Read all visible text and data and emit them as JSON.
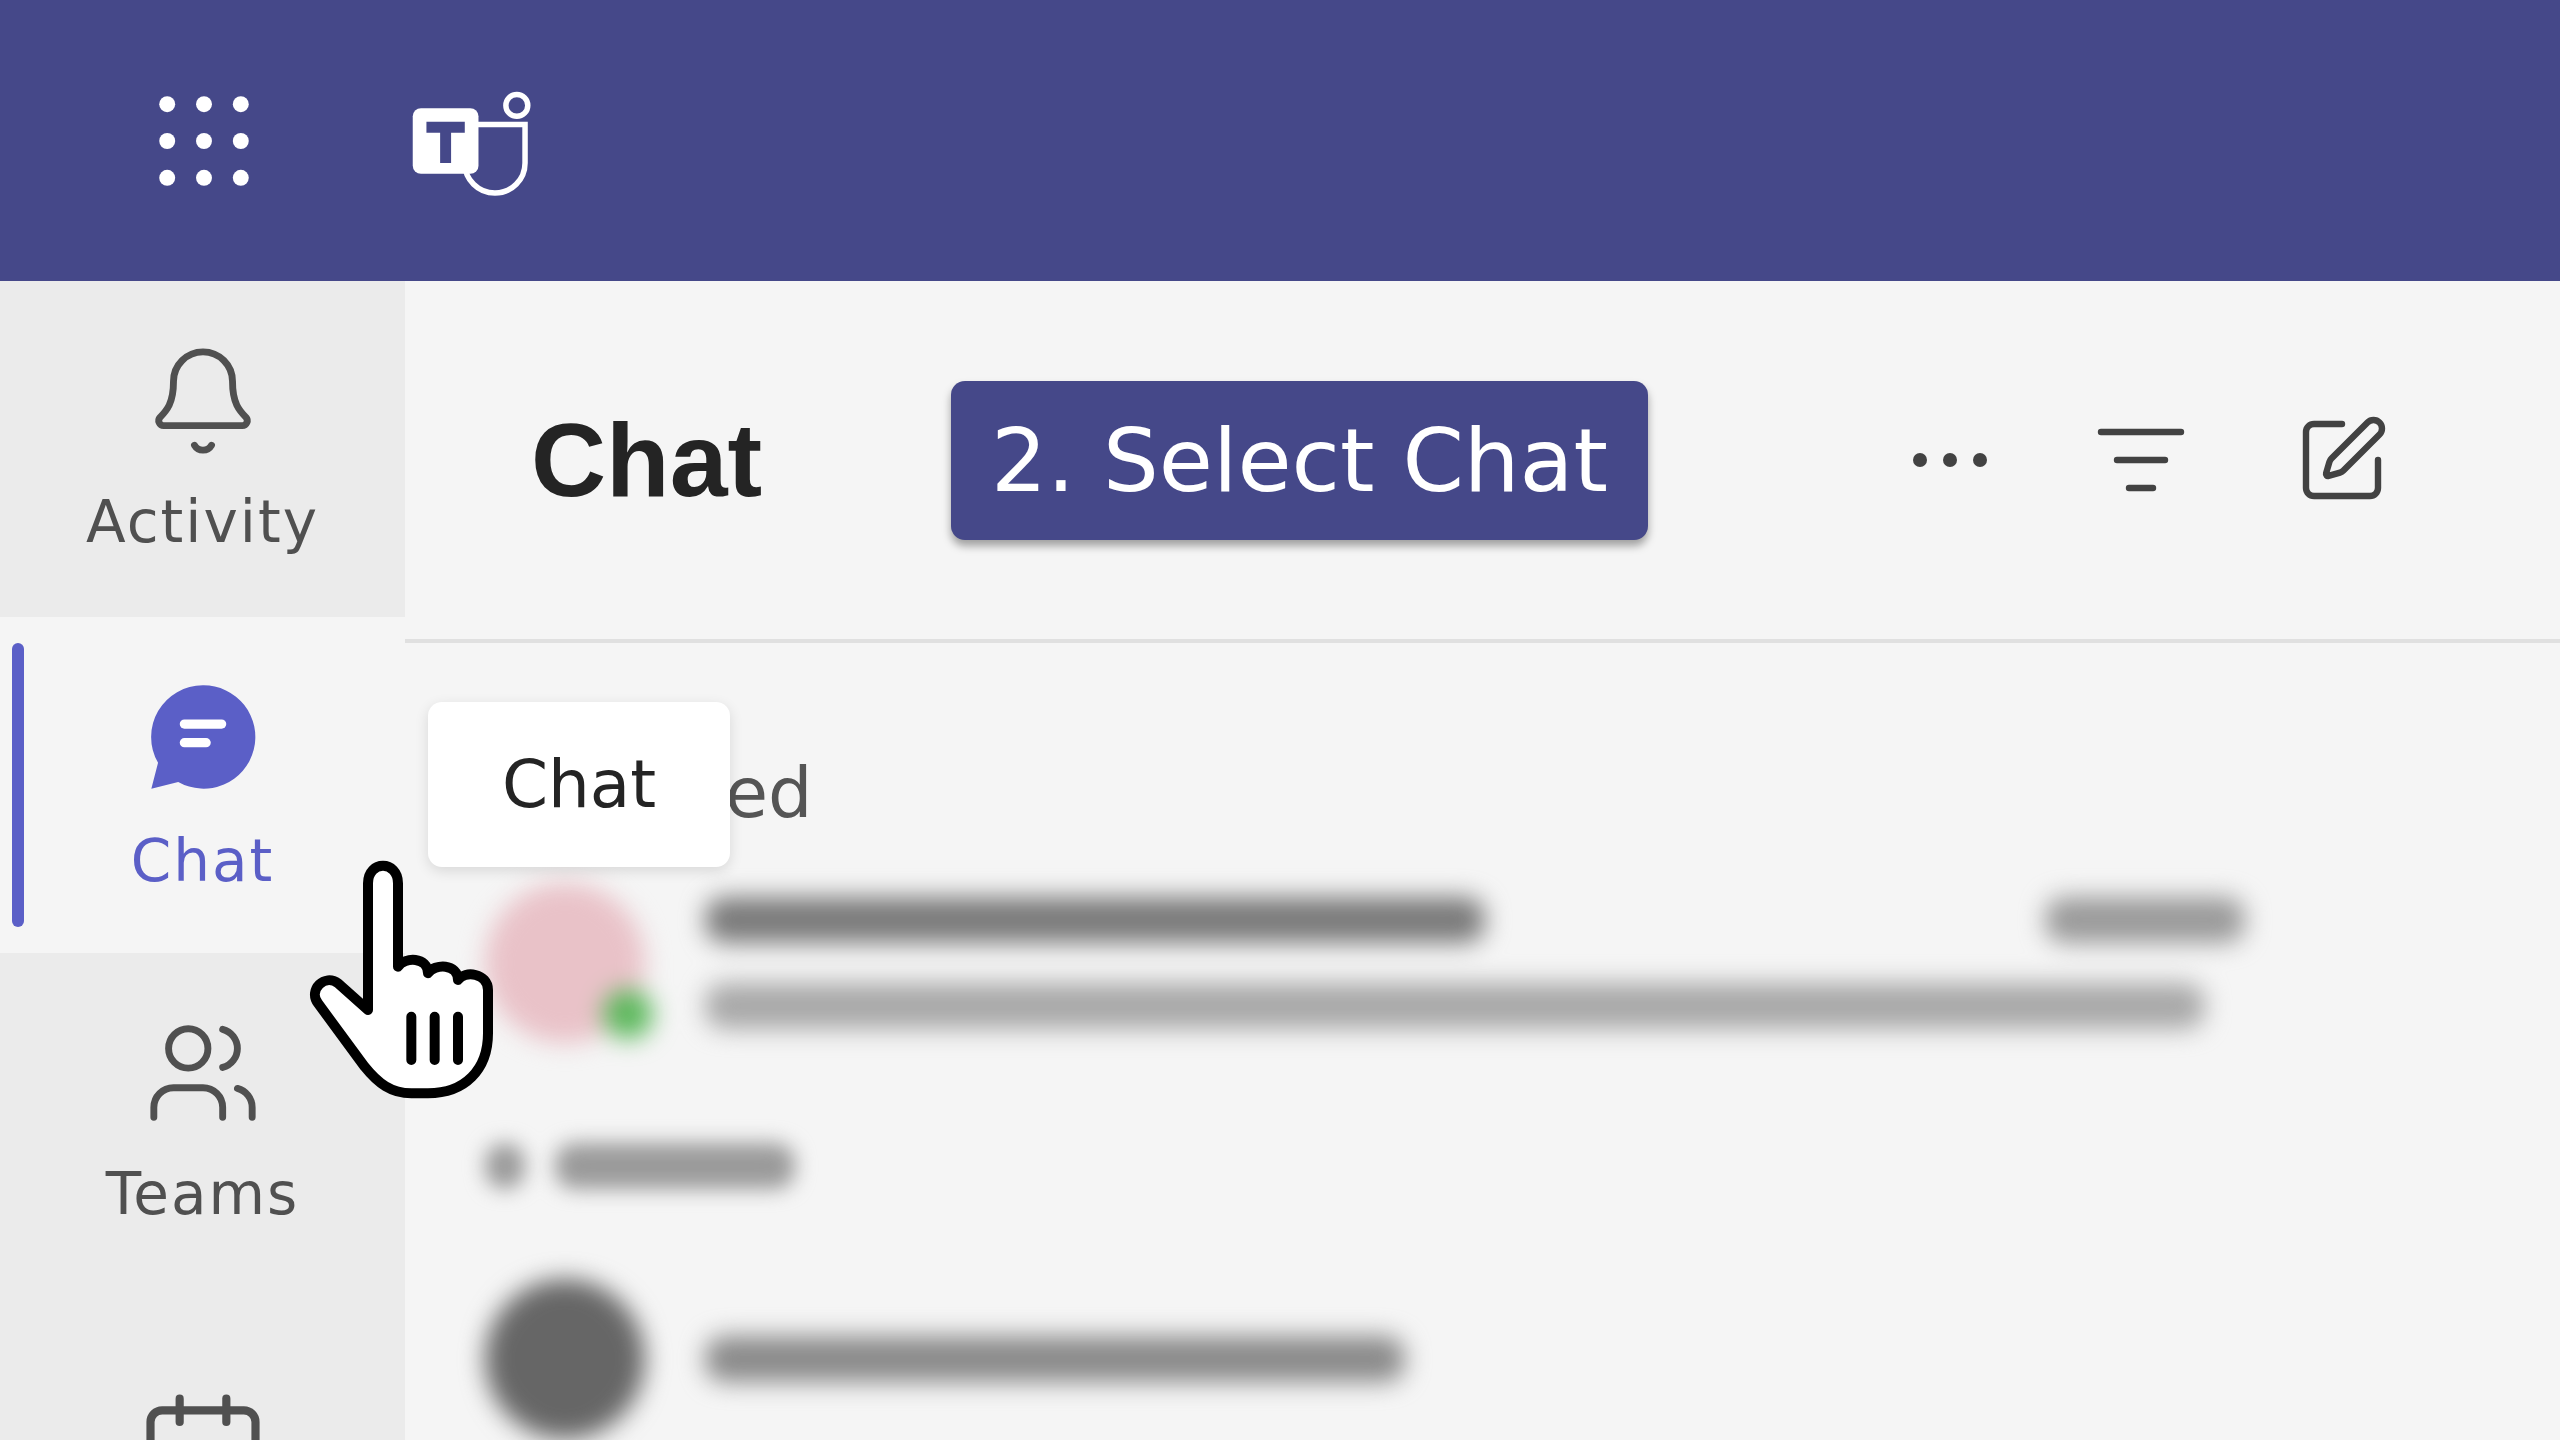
{
  "rail": {
    "items": [
      {
        "kind": "bell",
        "label": "Activity",
        "selected": false
      },
      {
        "kind": "chat",
        "label": "Chat",
        "selected": true
      },
      {
        "kind": "teams",
        "label": "Teams",
        "selected": false
      },
      {
        "kind": "calendar",
        "selected": false
      }
    ]
  },
  "header": {
    "title": "Chat",
    "callout": "2. Select Chat"
  },
  "tooltip": {
    "label": "Chat"
  },
  "list": {
    "section_label": "ed"
  }
}
